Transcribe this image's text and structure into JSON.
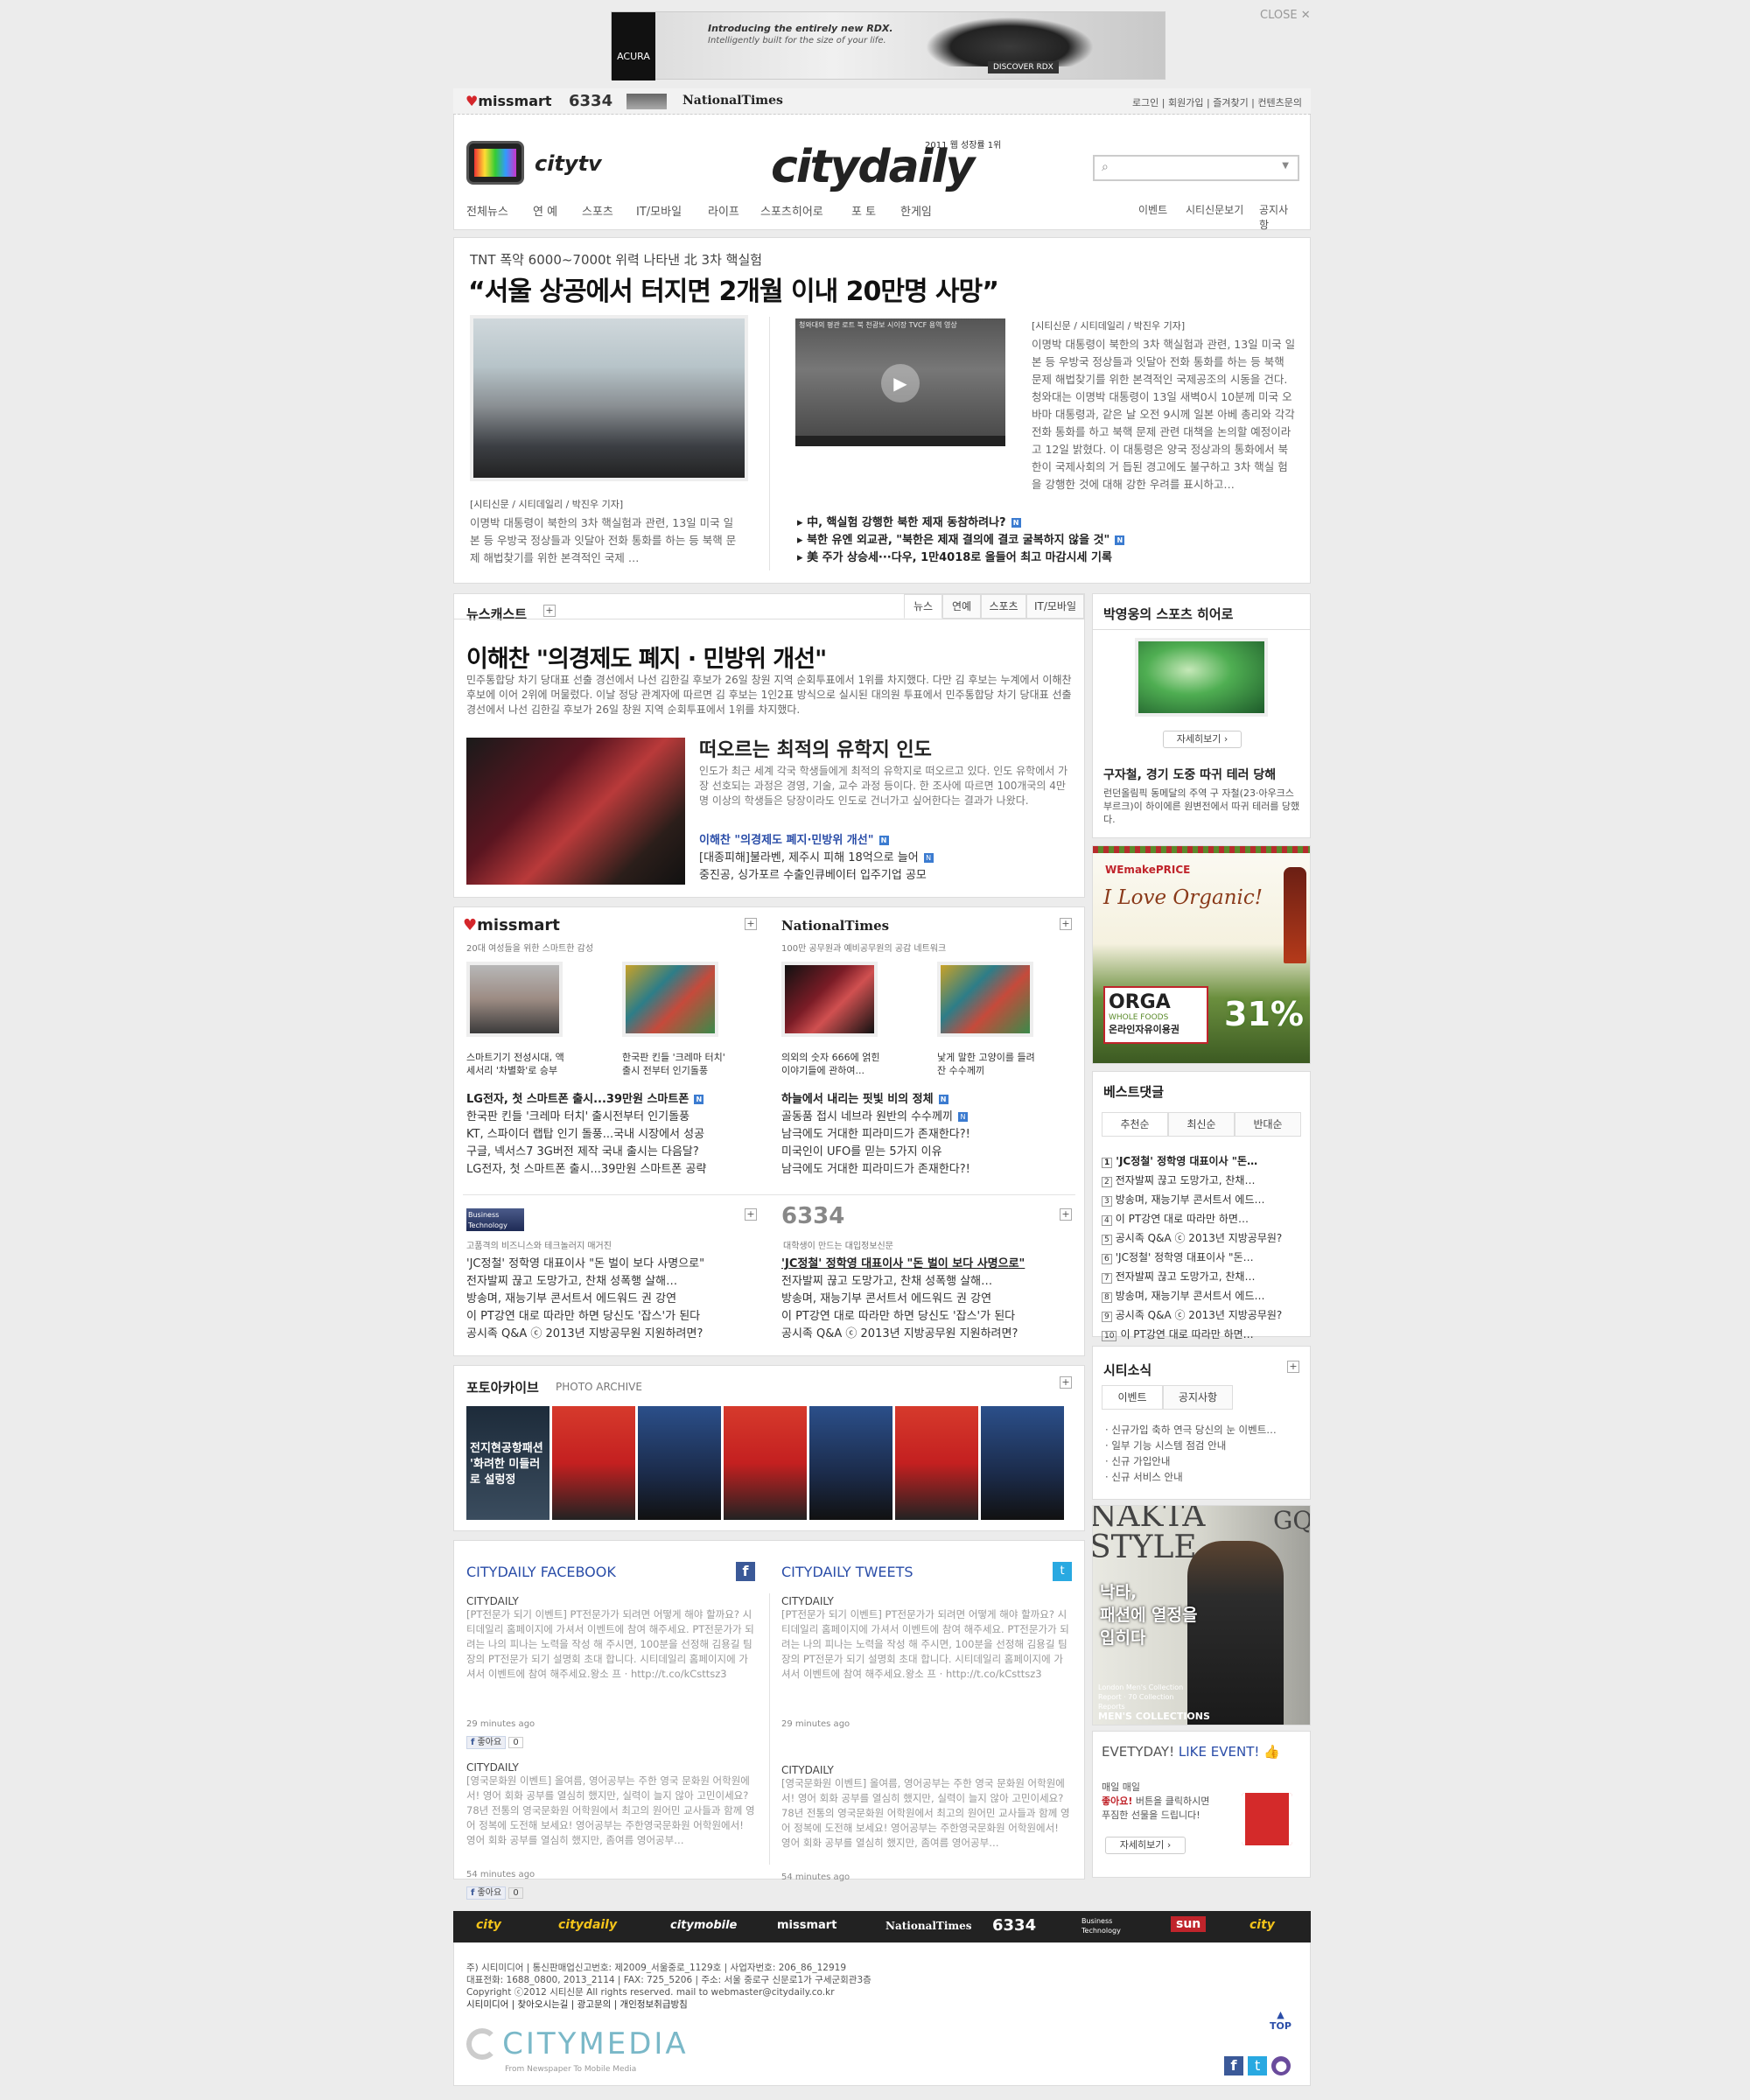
{
  "topad": {
    "line1": "Introducing the entirely new RDX.",
    "line2": "Intelligently built for the size of your life.",
    "brand": "ACURA",
    "cta": "DISCOVER RDX",
    "close": "CLOSE"
  },
  "topbar": {
    "brands": [
      "missmart",
      "6334",
      "NationalTimes"
    ],
    "links": [
      "로그인",
      "회원가입",
      "즐겨찾기",
      "컨텐츠문의"
    ]
  },
  "header": {
    "logo": "citydaily",
    "tagline": "2011 웹 성장률 1위",
    "tv": "citytv"
  },
  "nav": {
    "items": [
      "전체뉴스",
      "연 예",
      "스포츠",
      "IT/모바일",
      "라이프",
      "스포츠히어로",
      "포 토",
      "한게임"
    ],
    "right": [
      "이벤트",
      "시티신문보기",
      "공지사항"
    ]
  },
  "headline": {
    "kicker": "TNT 폭약 6000~7000t 위력 나타낸 北 3차 핵실험",
    "title": "“서울 상공에서 터지면 2개월 이내 20만명 사망”",
    "left_source": "[시티신문 / 시티데일리 / 박진우 기자]",
    "left_text": "이명박 대통령이 북한의 3차 핵실험과 관련, 13일 미국 일본 등 우방국 정상들과 잇달아 전화 통화를 하는 등 북핵 문제 해법찾기를 위한 본격적인 국제 …",
    "right_source": "[시티신문 / 시티데일리 / 박진우 기자]",
    "right_text": "이명박 대통령이 북한의 3차 핵실험과 관련, 13일 미국 일본 등 우방국 정상들과 잇달아 전화 통화를 하는 등 북핵 문제 해법찾기를 위한 본격적인 국제공조의 시동을 건다. 청와대는 이명박 대통령이 13일 새벽0시 10분께 미국 오바마 대통령과, 같은 날 오전 9시께 일본 아베 총리와 각각 전화 통화를 하고 북핵 문제 관련 대책을 논의할 예정이라고 12일 밝혔다. 이 대통령은 양국 정상과의 통화에서 북한이 국제사회의 거 듭된 경고에도 불구하고 3차 핵실 험을 강행한 것에 대해 강한 우려를 표시하고…",
    "video_label": "청와대의 평관 로트 북 천광보 시이장 TVCF 용역 영상",
    "links": [
      "中, 핵실험 강행한 북한 제재 동참하려나?",
      "북한 유엔 외교관, \"북한은 제재 결의에 결코 굴복하지 않을 것\"",
      "美 주가 상승세···다우, 1만4018로 올들어 최고 마감시세 기록"
    ]
  },
  "newscast": {
    "title": "뉴스캐스트",
    "tabs": [
      "뉴스",
      "연예",
      "스포츠",
      "IT/모바일"
    ],
    "headline": "이해찬 \"의경제도 폐지 · 민방위 개선\"",
    "text": "민주통합당 차기 당대표 선출 경선에서 나선 김한길 후보가 26일 창원 지역 순회투표에서 1위를 차지했다. 다만 김 후보는 누계에서 이해찬 후보에 이어 2위에 머물렀다. 이날 정당 관계자에 따르면 김 후보는 1인2표 방식으로 실시된 대의원 투표에서 민주통합당 차기 당대표 선출 경선에서 나선 김한길 후보가 26일 창원 지역 순회투표에서 1위를 차지했다.",
    "sub_title": "떠오르는 최적의 유학지 인도",
    "sub_text": "인도가 최근 세계 각국 학생들에게 최적의 유학지로 떠오르고 있다. 인도 유학에서 가장 선호되는 과정은 경영, 기술, 교수 과정 등이다. 한 조사에 따르면 100개국의 4만명 이상의 학생들은 당장이라도 인도로 건너가고 싶어한다는 결과가 나왔다.",
    "links": [
      "이해찬 \"의경제도 폐지·민방위 개선\"",
      "[대종피해]불라벤, 제주시 피해 18억으로 늘어",
      "중진공, 싱가포르 수출인큐베이터 입주기업 공모"
    ]
  },
  "missmart": {
    "name": "missmart",
    "sub": "20대 여성들을 위한 스마트한 감성",
    "thumbs": [
      "스마트기기 전성시대, 액세서리 '차별화'로 승부",
      "한국판 킨들 '크레마 터치' 출시 전부터 인기돌풍"
    ],
    "links": [
      "LG전자, 첫 스마트폰 출시...39만원 스마트폰",
      "한국판 킨들 '크레마 터치' 출시전부터 인기돌풍",
      "KT, 스파이더 랩탑 인기 돌풍...국내 시장에서 성공",
      "구글, 넥서스7 3G버전 제작 국내 출시는 다음달?",
      "LG전자, 첫 스마트폰 출시...39만원 스마트폰 공략"
    ]
  },
  "nationaltimes": {
    "name": "NationalTimes",
    "sub": "100만 공무원과 예비공무원의 공감 네트워크",
    "thumbs": [
      "의외의 숫자 666에 얽힌 이야기들에 관하여...",
      "낯게 말한 고양이를 들려잔 수수께끼"
    ],
    "links": [
      "하늘에서 내리는 핏빛 비의 정체",
      "골동품 접시 네브라 원반의 수수께끼",
      "남극에도 거대한 피라미드가 존재한다?!",
      "미국인이 UFO를 믿는 5가지 이유",
      "남극에도 거대한 피라미드가 존재한다?!"
    ]
  },
  "business": {
    "name": "Business Technology",
    "sub": "고품격의 비즈니스와 테크놀러지 매거진",
    "links": [
      "'JC정철' 정학영 대표이사 \"돈 벌이 보다 사명으로\"",
      "전자발찌 끊고 도망가고, 찬채 성폭행 살해…",
      "방송며, 재능기부 콘서트서 에드워드 권 강연",
      "이 PT강연 대로 따라만 하면 당신도 '잡스'가 된다",
      "공시족 Q&A ⓒ 2013년 지방공무원 지원하려면?"
    ]
  },
  "six": {
    "name": "6334",
    "sub": "대학생이 만드는 대입정보신문",
    "links": [
      "'JC정철' 정학영 대표이사 \"돈 벌이 보다 사명으로\"",
      "전자발찌 끊고 도망가고, 찬채 성폭행 살해…",
      "방송며, 재능기부 콘서트서 에드워드 권 강연",
      "이 PT강연 대로 따라만 하면 당신도 '잡스'가 된다",
      "공시족 Q&A ⓒ 2013년 지방공무원 지원하려면?"
    ]
  },
  "photo": {
    "title": "포토아카이브",
    "sub": "PHOTO ARCHIVE",
    "caption": "전지현공항패션 '화려한 미들러로 설렁정"
  },
  "social": {
    "fb_title": "CITYDAILY FACEBOOK",
    "tw_title": "CITYDAILY TWEETS",
    "author": "CITYDAILY",
    "post1": "[PT전문가 되기 이벤트] PT전문가가 되려면 어떻게 해야 할까요? 시티데일리 홈페이지에 가셔서 이벤트에 참여 해주세요. PT전문가가 되려는 나의 피나는 노력을 작성 해 주시면, 100분을 선정해 김용길 팀장의 PT전문가 되기 설명회 초대 합니다. 시티데일리 홈페이지에 가셔서 이벤트에 참여 해주세요.왕소 프 · http://t.co/kCsttsz3",
    "post2": "[영국문화원 이벤트] 올여름, 영어공부는 주한 영국 문화원 어학원에서! 영어 회화 공부를 열심히 했지만, 실력이 늘지 않아 고민이세요? 78년 전통의 영국문화원 어학원에서 최고의 원어민 교사들과 함께 영어 정복에 도전해 보세요! 영어공부는 주한영국문화원 어학원에서! 영어 회화 공부를 열심히 했지만, 좀여름 영어공부…",
    "time": "29 minutes ago",
    "time2": "54 minutes ago",
    "like": "좋아요",
    "count": "0"
  },
  "sports_hero": {
    "title": "박영웅의 스포츠 히어로",
    "more": "자세히보기",
    "headline": "구자철, 경기 도중 따귀 테러 당해",
    "text": "런던올림픽 동메달의 주역 구 자철(23·아우크스부르크)이 하이에른 원변전에서 따귀 테러를 당했다."
  },
  "organic": {
    "brand": "WEmakePRICE",
    "slogan": "I Love Organic!",
    "name": "ORGA",
    "sub": "WHOLE FOODS",
    "pct": "31%",
    "text": "온라인자유이용권"
  },
  "best": {
    "title": "베스트댓글",
    "tabs": [
      "추천순",
      "최신순",
      "반대순"
    ],
    "items": [
      "'JC정철' 정학영 대표이사 \"돈…",
      "전자발찌 끊고 도망가고, 찬채…",
      "방송며, 재능기부 콘서트서 에드…",
      "이 PT강연 대로 따라만 하면…",
      "공시족 Q&A ⓒ 2013년 지방공무원?",
      "'JC정철' 정학영 대표이사 \"돈…",
      "전자발찌 끊고 도망가고, 찬채…",
      "방송며, 재능기부 콘서트서 에드…",
      "공시족 Q&A ⓒ 2013년 지방공무원?",
      "이 PT강연 대로 따라만 하면…"
    ]
  },
  "citynews": {
    "title": "시티소식",
    "tabs": [
      "이벤트",
      "공지사항"
    ],
    "items": [
      "신규가입 축하 연극 당신의 눈 이벤트…",
      "일부 기능 시스템 점검 안내",
      "신규 가입안내",
      "신규 서비스 안내"
    ]
  },
  "nakta": {
    "title": "NAKTA STYLE",
    "mag": "GQ",
    "text1": "낙타,",
    "text2": "패션에 열정을",
    "text3": "입히다",
    "foot": "MEN'S COLLECTIONS",
    "sub": "London Men's Collection Report · 70 Collection Reports"
  },
  "event": {
    "title1": "EVETYDAY!",
    "title2": "LIKE EVENT!",
    "text1": "매일 매일",
    "text2": "좋아요!",
    "text3": " 버튼을 클릭하시면",
    "text4": "푸짐한 선물을 드립니다!",
    "more": "자세히보기"
  },
  "footer": {
    "brands": [
      "city",
      "citydaily",
      "citymobile",
      "missmart",
      "NationalTimes",
      "6334",
      "Business Technology",
      "sun",
      "city"
    ],
    "line1": "주) 시티미디어 | 통신판매업신고번호: 제2009_서울중로_1129호 | 사업자번호: 206_86_12919",
    "line2": "대표전화: 1688_0800, 2013_2114 | FAX: 725_5206 | 주소: 서울 중로구 신문로1가 구세군회관3층",
    "line3": "Copyright ⓒ2012 시티신문 All rights reserved. mail to webmaster@citydaily.co.kr",
    "line4": "시티미디어 | 찾아오시는길 | 광고문의 | 개인정보취급방침",
    "company": "CITYMEDIA",
    "slogan": "From Newspaper To Mobile Media",
    "top": "TOP"
  },
  "colors": {
    "accent": "#d4262b",
    "link": "#2a4da8",
    "nav": "#555555"
  }
}
